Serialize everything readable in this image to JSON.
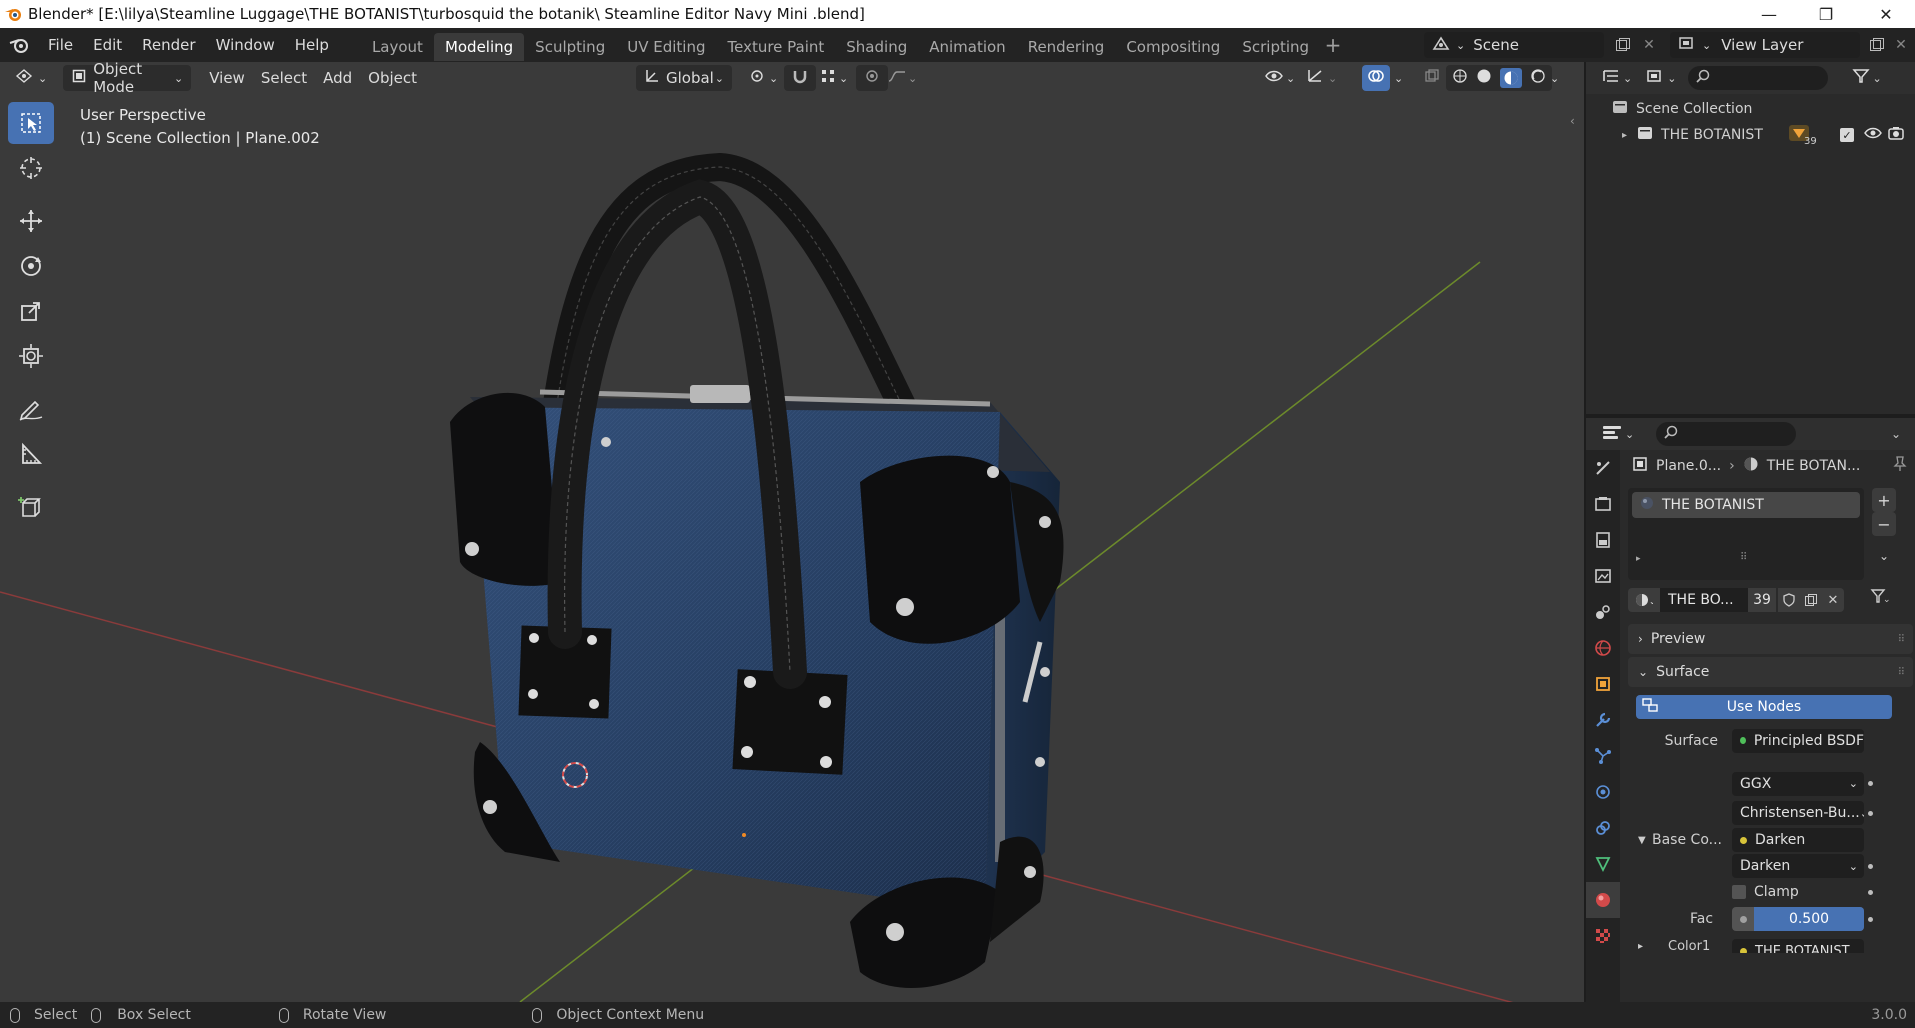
{
  "window": {
    "title": "Blender* [E:\\lilya\\Steamline Luggage\\THE BOTANIST\\turbosquid the botanik\\ Steamline Editor Navy Mini .blend]",
    "minimize": "—",
    "restore": "❐",
    "close": "✕"
  },
  "menu": [
    "File",
    "Edit",
    "Render",
    "Window",
    "Help"
  ],
  "workspaces": [
    "Layout",
    "Modeling",
    "Sculpting",
    "UV Editing",
    "Texture Paint",
    "Shading",
    "Animation",
    "Rendering",
    "Compositing",
    "Scripting"
  ],
  "active_workspace": "Modeling",
  "scene": {
    "name": "Scene"
  },
  "view_layer": {
    "name": "View Layer"
  },
  "viewport": {
    "mode": "Object Mode",
    "menus": [
      "View",
      "Select",
      "Add",
      "Object"
    ],
    "orientation": "Global",
    "overlay_line1": "User Perspective",
    "overlay_line2": "(1) Scene Collection | Plane.002"
  },
  "tools": [
    "select-box-tool",
    "cursor-tool",
    "move-tool",
    "rotate-tool",
    "scale-tool",
    "transform-tool",
    "annotate-tool",
    "measure-tool",
    "add-cube-tool"
  ],
  "outliner": {
    "root": "Scene Collection",
    "items": [
      {
        "name": "THE BOTANIST",
        "count": "39"
      }
    ]
  },
  "properties": {
    "breadcrumb_object": "Plane.0...",
    "breadcrumb_material": "THE BOTAN...",
    "material_slot": "THE BOTANIST",
    "material_name": "THE BO...",
    "users": "39",
    "sections": {
      "preview": "Preview",
      "surface": "Surface"
    },
    "use_nodes": "Use Nodes",
    "surface_label": "Surface",
    "surface_value": "Principled BSDF",
    "distribution": "GGX",
    "subsurface": "Christensen-Bu...",
    "base_color_label": "Base Co...",
    "base_color_value": "Darken",
    "blend_mode": "Darken",
    "clamp": "Clamp",
    "fac_label": "Fac",
    "fac_value": "0.500",
    "color1_label": "Color1",
    "color1_value": "THE BOTANIST"
  },
  "status": {
    "select": "Select",
    "box_select": "Box Select",
    "rotate": "Rotate View",
    "context": "Object Context Menu",
    "version": "3.0.0"
  }
}
